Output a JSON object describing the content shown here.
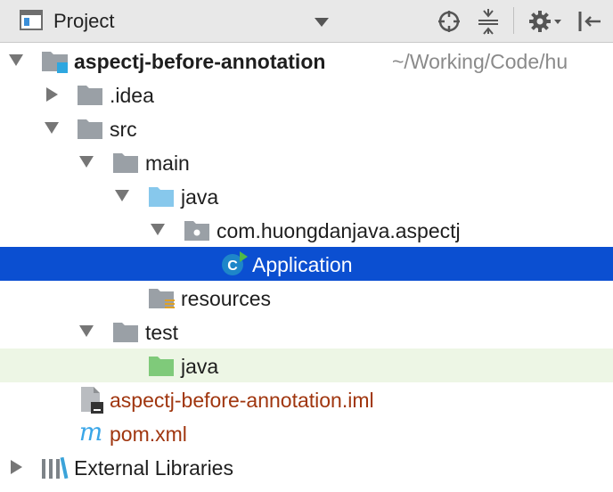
{
  "toolbar": {
    "title": "Project",
    "icons": [
      "project-view-icon",
      "dropdown-icon",
      "locate-icon",
      "collapse-all-icon",
      "gear-icon",
      "hide-panel-icon"
    ]
  },
  "tree": {
    "root": {
      "label": "aspectj-before-annotation",
      "path": "~/Working/Code/hu"
    },
    "idea": "idea_label",
    "idea_label": ".idea",
    "src": "src",
    "main": "main",
    "java": "java",
    "package": "com.huongdanjava.aspectj",
    "application": "Application",
    "resources": "resources",
    "test": "test",
    "test_java": "java",
    "iml": "aspectj-before-annotation.iml",
    "pom": "pom.xml",
    "external": "External Libraries"
  },
  "colors": {
    "selection": "#0b4fd1",
    "hover_row": "#edf6e5",
    "source_folder": "#87c8ec",
    "test_folder": "#7fca7a",
    "module_file_text": "#a0360f",
    "maven_m": "#3aa6e8"
  }
}
